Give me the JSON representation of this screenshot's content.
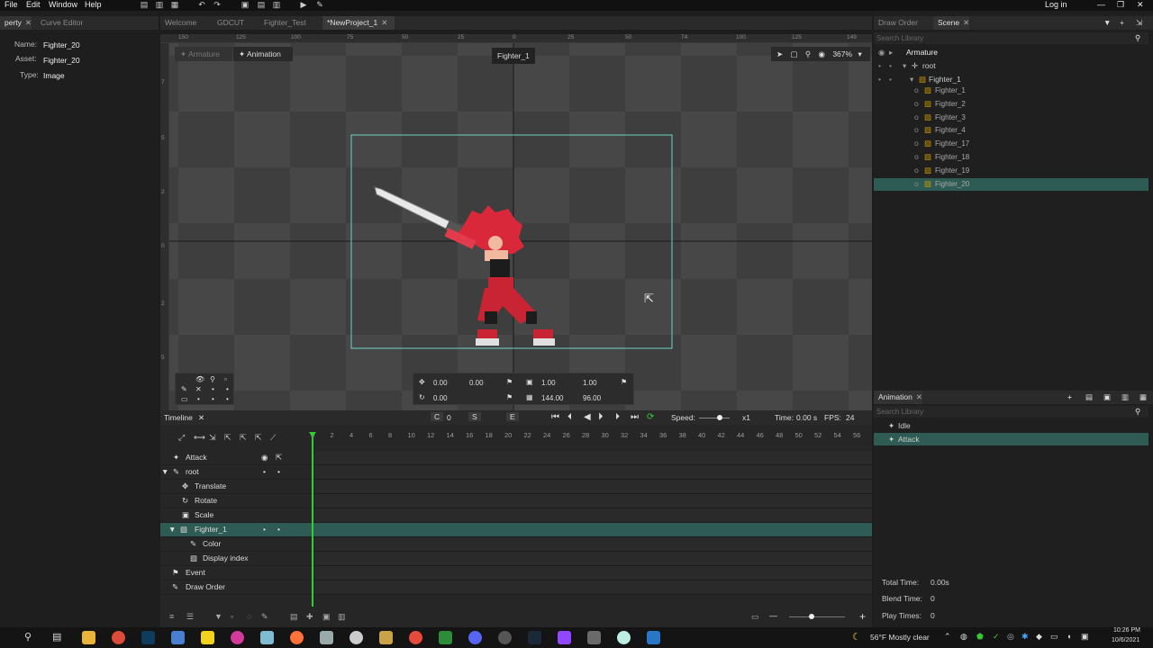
{
  "menubar": {
    "items": [
      "File",
      "Edit",
      "Window",
      "Help"
    ],
    "login": "Log in"
  },
  "left_tabs": {
    "property": "perty",
    "curve_editor": "Curve Editor"
  },
  "doc_tabs": [
    "Welcome",
    "GDCUT",
    "Fighter_Test",
    "*NewProject_1"
  ],
  "property": {
    "name_label": "Name:",
    "name_value": "Fighter_20",
    "asset_label": "Asset:",
    "asset_value": "Fighter_20",
    "type_label": "Type:",
    "type_value": "Image"
  },
  "viewport": {
    "mode_armature": "Armature",
    "mode_animation": "Animation",
    "bone_label": "Fighter_1",
    "zoom": "367%",
    "ruler_top": [
      "150",
      "125",
      "100",
      "75",
      "50",
      "25",
      "0",
      "25",
      "50",
      "74",
      "100",
      "125",
      "149"
    ],
    "ruler_left": [
      "7",
      "5",
      "2",
      "0",
      "2",
      "5",
      "5"
    ],
    "transform": {
      "x": "0.00",
      "y": "0.00",
      "scale_x": "1.00",
      "scale_y": "1.00",
      "rotation": "0.00",
      "width": "144.00",
      "height": "96.00"
    }
  },
  "timeline": {
    "title": "Timeline",
    "btn_c": "C",
    "c_val": "0",
    "btn_s": "S",
    "btn_e": "E",
    "speed_label": "Speed:",
    "speed_val": "x1",
    "time_label": "Time:",
    "time_val": "0.00 s",
    "fps_label": "FPS:",
    "fps_val": "24",
    "frames": [
      "0",
      "2",
      "4",
      "6",
      "8",
      "10",
      "12",
      "14",
      "16",
      "18",
      "20",
      "22",
      "24",
      "26",
      "28",
      "30",
      "32",
      "34",
      "36",
      "38",
      "40",
      "42",
      "44",
      "46",
      "48",
      "50",
      "52",
      "54",
      "56"
    ],
    "rows": [
      "Attack",
      "root",
      "Translate",
      "Rotate",
      "Scale",
      "Fighter_1",
      "Color",
      "Display index",
      "Event",
      "Draw Order"
    ]
  },
  "right_tabs": {
    "draw_order": "Draw Order",
    "scene": "Scene"
  },
  "scene": {
    "search_placeholder": "Search Library",
    "armature": "Armature",
    "root": "root",
    "fighter_1": "Fighter_1",
    "children": [
      "Fighter_1",
      "Fighter_2",
      "Fighter_3",
      "Fighter_4",
      "Fighter_17",
      "Fighter_18",
      "Fighter_19",
      "Fighter_20"
    ]
  },
  "animation": {
    "title": "Animation",
    "search_placeholder": "Search Library",
    "items": [
      "Idle",
      "Attack"
    ],
    "total_time_label": "Total Time:",
    "total_time_val": "0.00s",
    "blend_time_label": "Blend Time:",
    "blend_time_val": "0",
    "play_times_label": "Play Times:",
    "play_times_val": "0"
  },
  "taskbar": {
    "weather": "56°F  Mostly clear",
    "time": "10:26 PM",
    "date": "10/6/2021"
  },
  "colors": {
    "accent": "#2f5b55",
    "playhead": "#33cc33",
    "box": "#6fd3c3"
  }
}
